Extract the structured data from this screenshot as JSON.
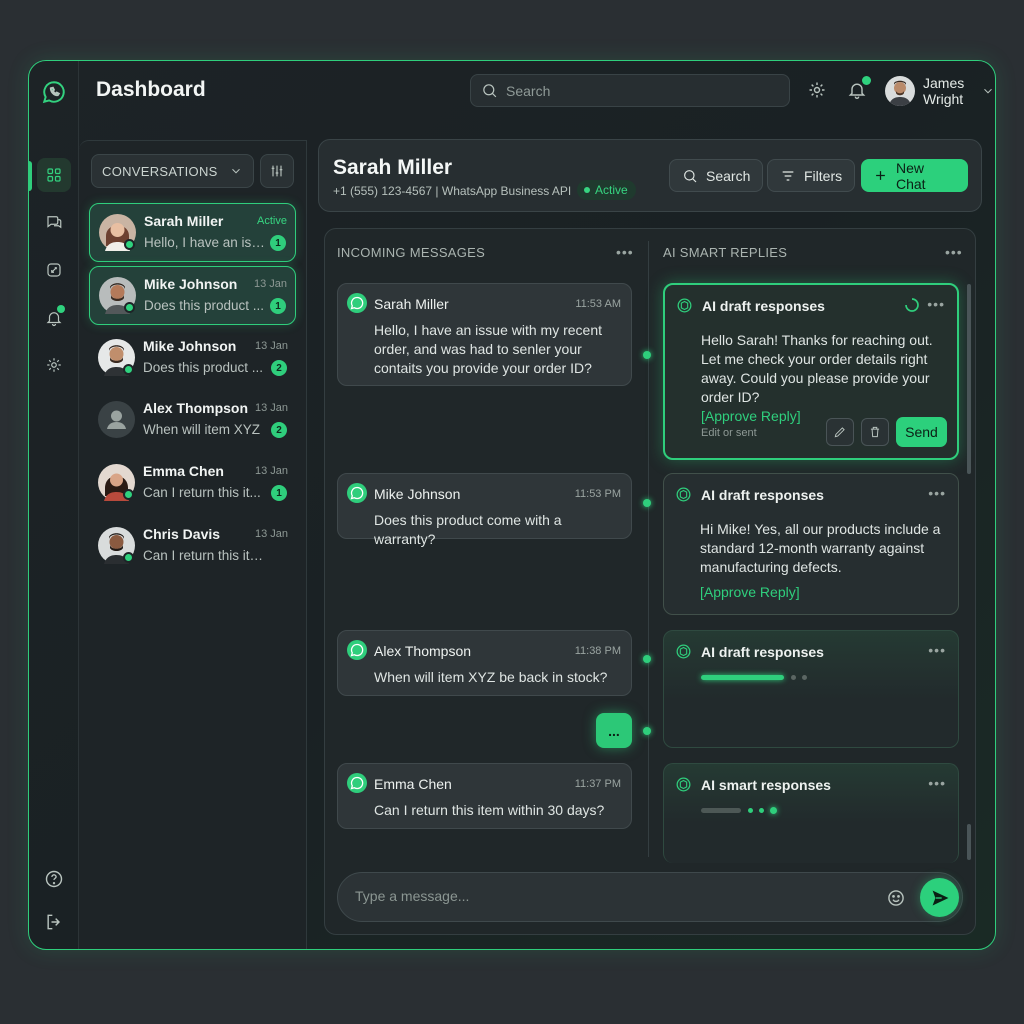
{
  "app": {
    "title": "Dashboard"
  },
  "search": {
    "placeholder": "Search"
  },
  "user": {
    "name": "James Wright"
  },
  "conversations": {
    "header": "CONVERSATIONS",
    "items": [
      {
        "name": "Sarah Miller",
        "time": "Active",
        "preview": "Hello, I have an issue...",
        "badge": "1"
      },
      {
        "name": "Mike Johnson",
        "time": "13 Jan",
        "preview": "Does this product ...",
        "badge": "1"
      },
      {
        "name": "Mike Johnson",
        "time": "13 Jan",
        "preview": "Does this product ...",
        "badge": "2"
      },
      {
        "name": "Alex Thompson",
        "time": "13 Jan",
        "preview": "When will item XYZ",
        "badge": "2"
      },
      {
        "name": "Emma Chen",
        "time": "13 Jan",
        "preview": "Can I return this it...",
        "badge": "1"
      },
      {
        "name": "Chris Davis",
        "time": "13 Jan",
        "preview": "Can I return this ite...",
        "badge": ""
      }
    ]
  },
  "chat": {
    "name": "Sarah Miller",
    "subtitle": "+1 (555) 123-4567 | WhatsApp Business API",
    "status": "Active",
    "search_label": "Search",
    "filters_label": "Filters",
    "new_chat_label": "New Chat"
  },
  "incoming": {
    "header": "INCOMING MESSAGES",
    "messages": [
      {
        "name": "Sarah Miller",
        "time": "11:53 AM",
        "text": "Hello, I have an issue with my recent order, and was had to senler your contaits you  provide your order ID?"
      },
      {
        "name": "Mike Johnson",
        "time": "11:53 PM",
        "text": "Does this product come with a warranty?"
      },
      {
        "name": "Alex Thompson",
        "time": "11:38 PM",
        "text": "When will item XYZ be back in stock?"
      },
      {
        "name": "Emma Chen",
        "time": "11:37 PM",
        "text": "Can I return this item within 30 days?"
      }
    ],
    "typing": "..."
  },
  "ai": {
    "header": "AI SMART REPLIES",
    "cards": [
      {
        "title": "AI draft responses",
        "body": "Hello Sarah! Thanks for reaching out. Let me check your order details right away. Could you please provide your order ID?",
        "approve": "[Approve Reply]",
        "edit_label": "Edit or sent",
        "send": "Send"
      },
      {
        "title": "AI draft responses",
        "body": "Hi Mike! Yes, all our products include a standard 12-month warranty against manufacturing defects.",
        "approve": "[Approve Reply]"
      },
      {
        "title": "AI draft responses"
      },
      {
        "title": "AI smart responses"
      }
    ]
  },
  "composer": {
    "placeholder": "Type a message..."
  },
  "icons": [
    "whatsapp-icon",
    "grid-icon",
    "chat-icon",
    "analytics-icon",
    "bell-icon",
    "gear-icon",
    "help-icon",
    "logout-icon",
    "search-icon",
    "chevron-down-icon",
    "filter-icon",
    "plus-icon",
    "more-icon",
    "openai-icon",
    "pencil-icon",
    "trash-icon",
    "emoji-icon",
    "send-icon",
    "spinner-icon"
  ],
  "colors": {
    "accent": "#2fce7c",
    "background": "#1d2326"
  }
}
